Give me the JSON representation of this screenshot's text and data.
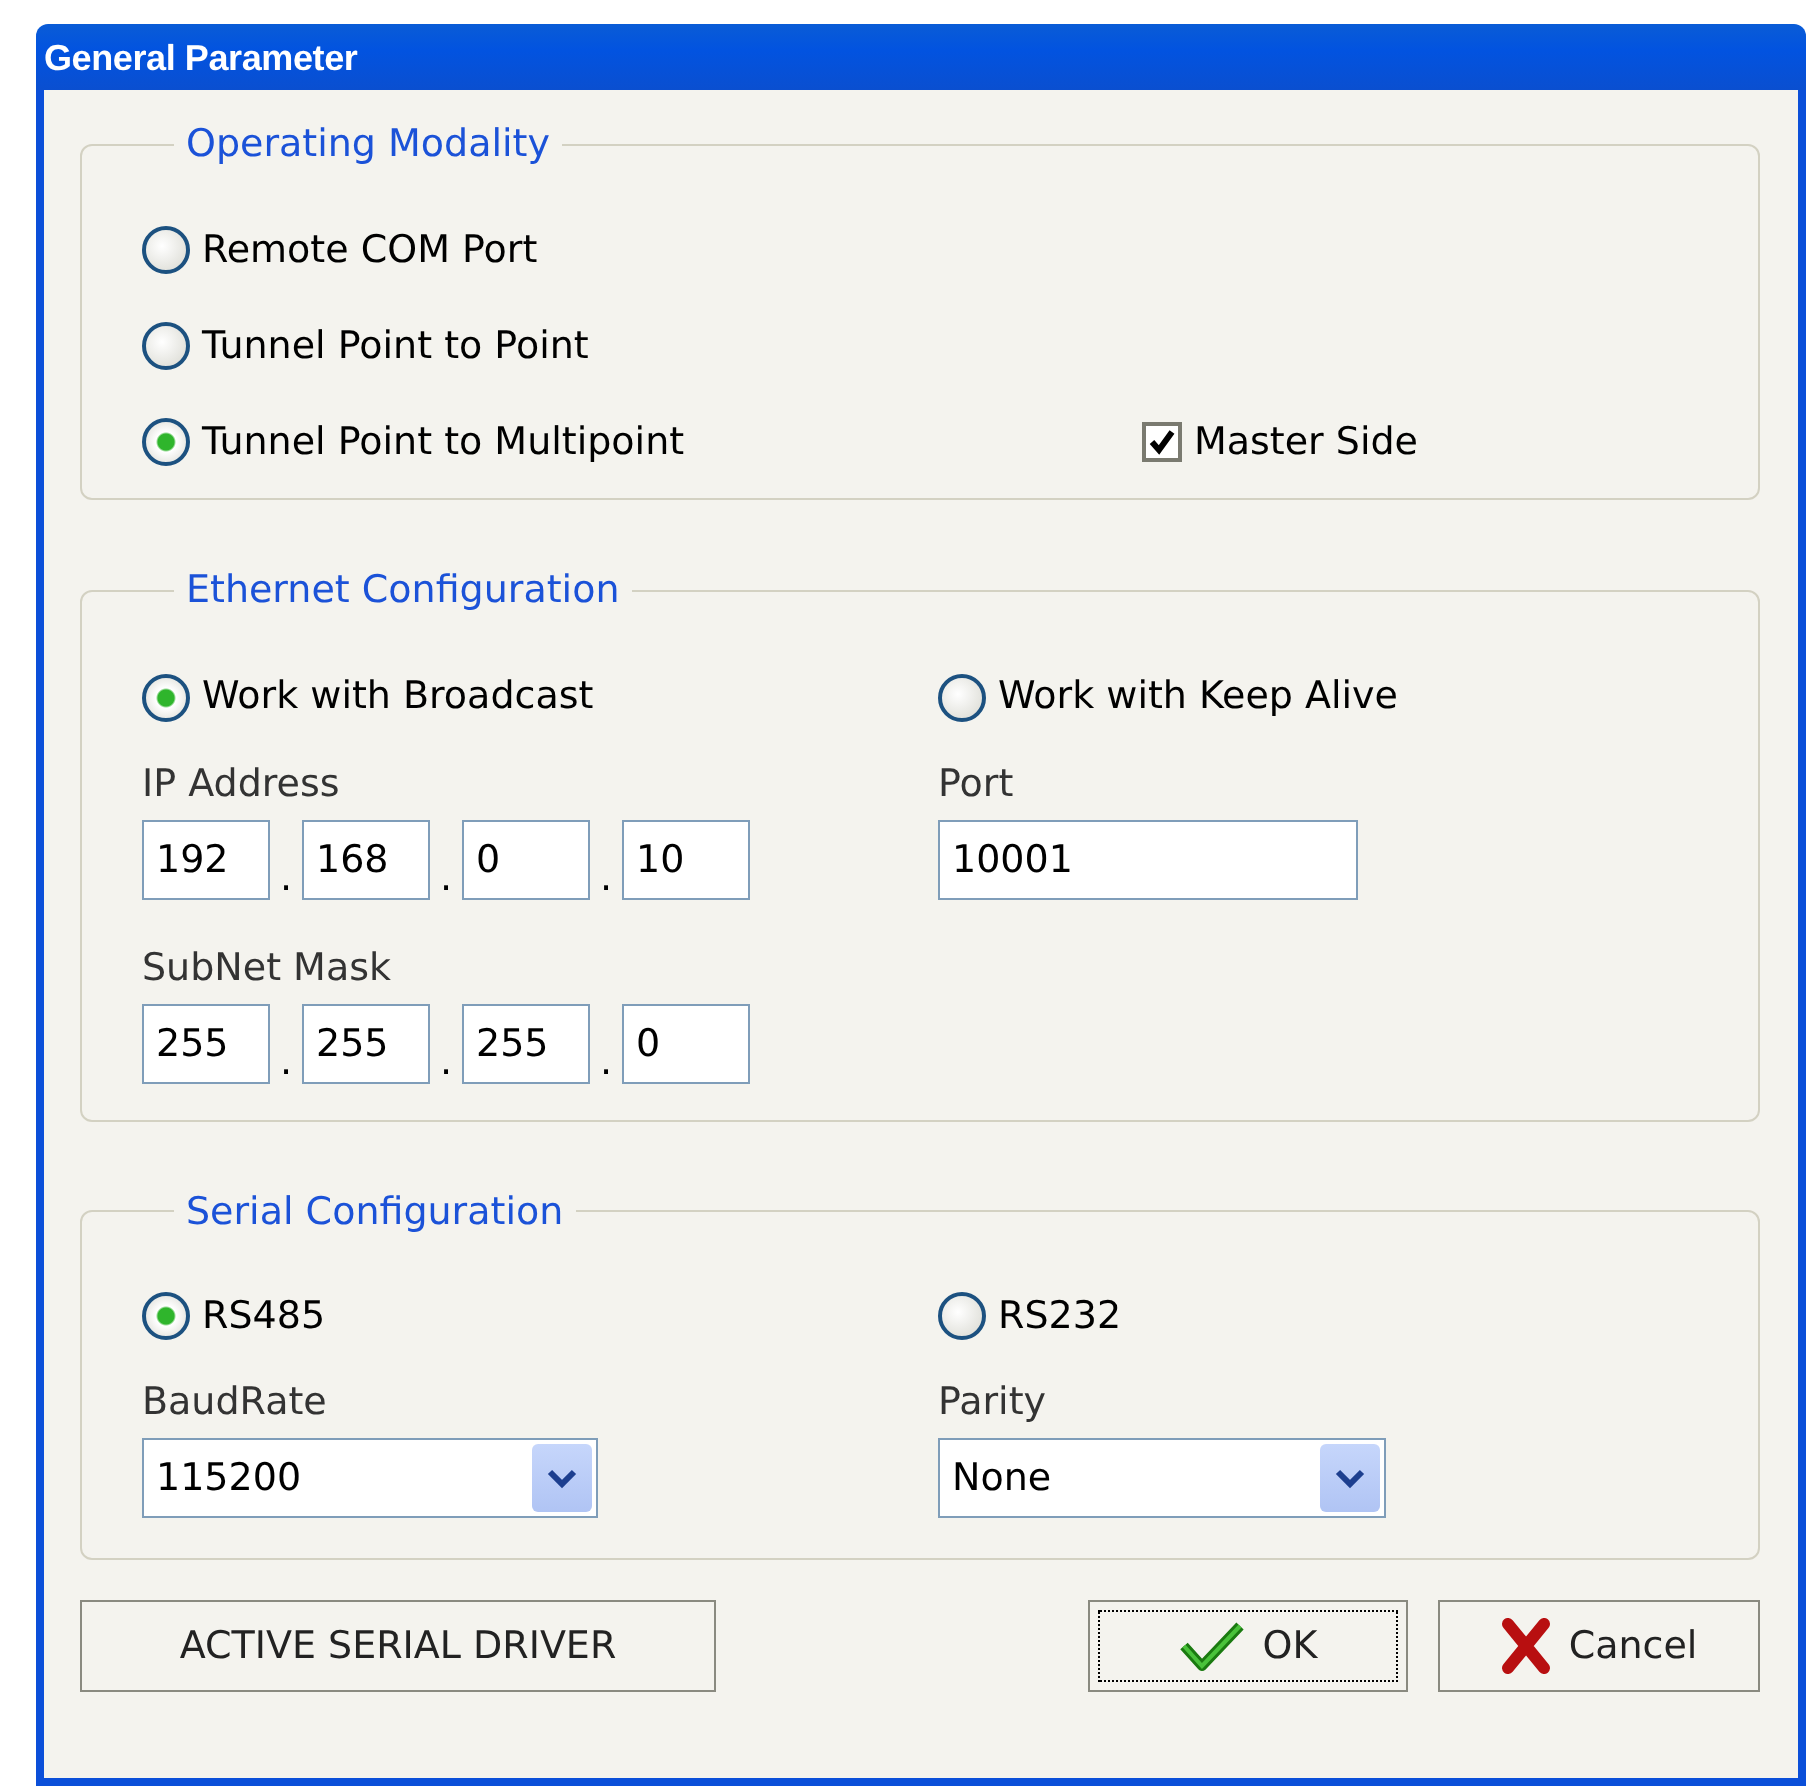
{
  "window": {
    "title": "General Parameter"
  },
  "operating_modality": {
    "title": "Operating Modality",
    "options": [
      {
        "label": "Remote COM Port",
        "selected": false
      },
      {
        "label": "Tunnel Point to Point",
        "selected": false
      },
      {
        "label": "Tunnel Point to Multipoint",
        "selected": true
      }
    ],
    "master_side": {
      "label": "Master Side",
      "checked": true
    }
  },
  "ethernet_configuration": {
    "title": "Ethernet Configuration",
    "options": [
      {
        "label": "Work with Broadcast",
        "selected": true
      },
      {
        "label": "Work with Keep Alive",
        "selected": false
      }
    ],
    "ip_address": {
      "label": "IP Address",
      "separator": ".",
      "octets": [
        "192",
        "168",
        "0",
        "10"
      ]
    },
    "port": {
      "label": "Port",
      "value": "10001"
    },
    "subnet_mask": {
      "label": "SubNet Mask",
      "separator": ".",
      "octets": [
        "255",
        "255",
        "255",
        "0"
      ]
    }
  },
  "serial_configuration": {
    "title": "Serial Configuration",
    "options": [
      {
        "label": "RS485",
        "selected": true
      },
      {
        "label": "RS232",
        "selected": false
      }
    ],
    "baud_rate": {
      "label": "BaudRate",
      "value": "115200"
    },
    "parity": {
      "label": "Parity",
      "value": "None"
    }
  },
  "buttons": [
    {
      "label": "ACTIVE SERIAL DRIVER",
      "kind": "plain",
      "focused": false
    },
    {
      "label": "OK",
      "kind": "ok",
      "focused": true
    },
    {
      "label": "Cancel",
      "kind": "cancel",
      "focused": false
    }
  ]
}
